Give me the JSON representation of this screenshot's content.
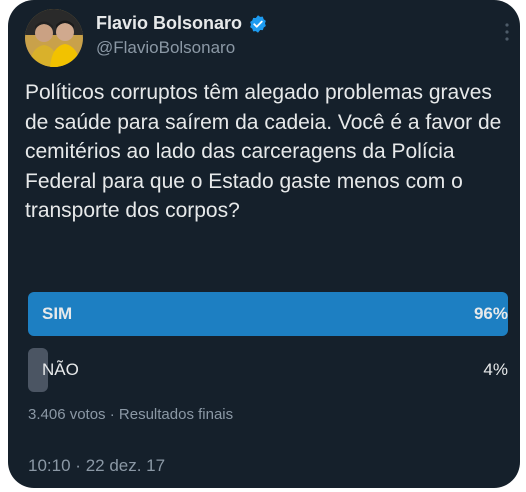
{
  "tweet": {
    "author": {
      "display_name": "Flavio Bolsonaro",
      "handle": "@FlavioBolsonaro",
      "verified": true,
      "avatar_icon": "profile-photo-icon",
      "verified_icon": "verified-badge-icon"
    },
    "text": "Políticos corruptos têm alegado problemas graves de saúde para saírem da cadeia. Você é a favor de cemitérios ao lado das carceragens da Polícia Federal para que o Estado gaste menos com o transporte dos corpos?",
    "poll": {
      "options": [
        {
          "label": "SIM",
          "percent_label": "96%",
          "percent": 96,
          "winner": true
        },
        {
          "label": "NÃO",
          "percent_label": "4%",
          "percent": 4,
          "winner": false
        }
      ],
      "votes_text": "3.406 votos",
      "separator": "·",
      "status": "Resultados finais"
    },
    "timestamp": {
      "time": "10:10",
      "separator": "·",
      "date": "22 dez. 17"
    }
  },
  "colors": {
    "background": "#15202b",
    "text": "#e7e9ea",
    "secondary_text": "#8b98a5",
    "winner_bar": "#1d7fc2",
    "loser_bar": "#4b5563",
    "verified": "#1d9bf0"
  }
}
